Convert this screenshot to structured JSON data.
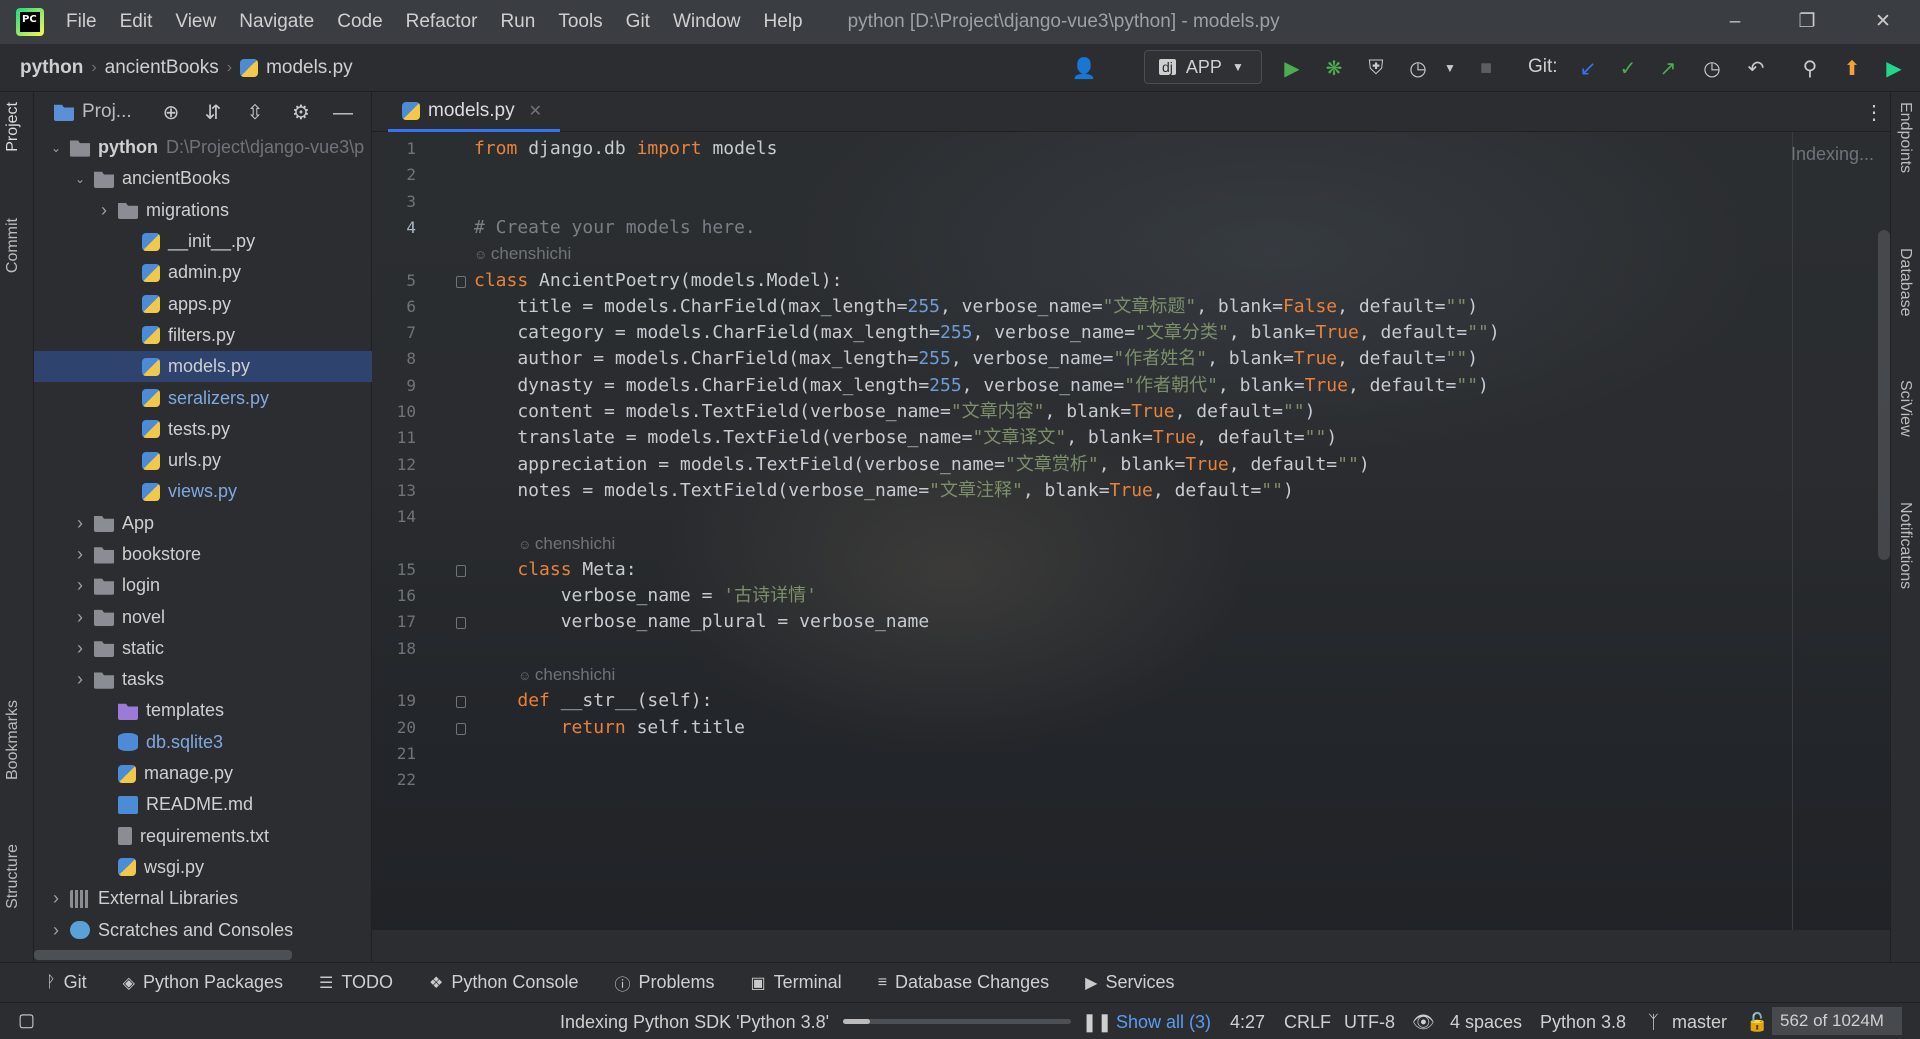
{
  "titlebar": {
    "menu": [
      "File",
      "Edit",
      "View",
      "Navigate",
      "Code",
      "Refactor",
      "Run",
      "Tools",
      "Git",
      "Window",
      "Help"
    ],
    "window_title": "python [D:\\Project\\django-vue3\\python] - models.py",
    "logo": "PC"
  },
  "navbar": {
    "breadcrumb": [
      "python",
      "ancientBooks",
      "models.py"
    ],
    "run_config": "APP",
    "git_label": "Git:"
  },
  "left_strip": {
    "tabs": [
      "Project",
      "Commit",
      "Bookmarks",
      "Structure"
    ]
  },
  "right_strip": {
    "tabs": [
      "Endpoints",
      "Database",
      "SciView",
      "Notifications"
    ]
  },
  "project_panel": {
    "title": "Proj...",
    "tree": [
      {
        "label": "python",
        "path": "D:\\Project\\django-vue3\\p",
        "type": "folder",
        "depth": 0,
        "expanded": true
      },
      {
        "label": "ancientBooks",
        "type": "folder",
        "depth": 1,
        "expanded": true
      },
      {
        "label": "migrations",
        "type": "folder",
        "depth": 2,
        "expanded": false
      },
      {
        "label": "__init__.py",
        "type": "py",
        "depth": 3
      },
      {
        "label": "admin.py",
        "type": "py",
        "depth": 3
      },
      {
        "label": "apps.py",
        "type": "py",
        "depth": 3
      },
      {
        "label": "filters.py",
        "type": "py",
        "depth": 3
      },
      {
        "label": "models.py",
        "type": "py",
        "depth": 3,
        "selected": true
      },
      {
        "label": "seralizers.py",
        "type": "py",
        "depth": 3,
        "blue": true
      },
      {
        "label": "tests.py",
        "type": "py",
        "depth": 3
      },
      {
        "label": "urls.py",
        "type": "py",
        "depth": 3
      },
      {
        "label": "views.py",
        "type": "py",
        "depth": 3,
        "blue": true
      },
      {
        "label": "App",
        "type": "folder",
        "depth": 1,
        "expanded": false
      },
      {
        "label": "bookstore",
        "type": "folder",
        "depth": 1,
        "expanded": false
      },
      {
        "label": "login",
        "type": "folder",
        "depth": 1,
        "expanded": false
      },
      {
        "label": "novel",
        "type": "folder",
        "depth": 1,
        "expanded": false
      },
      {
        "label": "static",
        "type": "folder",
        "depth": 1,
        "expanded": false
      },
      {
        "label": "tasks",
        "type": "folder",
        "depth": 1,
        "expanded": false
      },
      {
        "label": "templates",
        "type": "folder-purple",
        "depth": 2
      },
      {
        "label": "db.sqlite3",
        "type": "db",
        "depth": 2,
        "blue": true
      },
      {
        "label": "manage.py",
        "type": "py",
        "depth": 2
      },
      {
        "label": "README.md",
        "type": "md",
        "depth": 2
      },
      {
        "label": "requirements.txt",
        "type": "txt",
        "depth": 2
      },
      {
        "label": "wsgi.py",
        "type": "py",
        "depth": 2
      },
      {
        "label": "External Libraries",
        "type": "lib",
        "depth": 0,
        "expanded": false
      },
      {
        "label": "Scratches and Consoles",
        "type": "scratch",
        "depth": 0,
        "expanded": false
      }
    ]
  },
  "editor": {
    "tab": "models.py",
    "indexing_hint": "Indexing...",
    "author_hint": "chenshichi",
    "lines": [
      {
        "n": "1",
        "html": "<span class='kw'>from</span> django.db <span class='kw'>import</span> models"
      },
      {
        "n": "2",
        "html": ""
      },
      {
        "n": "3",
        "html": ""
      },
      {
        "n": "4",
        "html": "<span class='cmt'># Create your models here.</span>",
        "current": true
      },
      {
        "inlay": true,
        "indent": 0
      },
      {
        "n": "5",
        "html": "<span class='kw'>class</span> AncientPoetry(models.Model):",
        "fold": true
      },
      {
        "n": "6",
        "html": "    title = models.CharField(max_length=<span class='num'>255</span>, verbose_name=<span class='str'>\"文章标题\"</span>, blank=<span class='kw'>False</span>, default=<span class='str'>\"\"</span>)"
      },
      {
        "n": "7",
        "html": "    category = models.CharField(max_length=<span class='num'>255</span>, verbose_name=<span class='str'>\"文章分类\"</span>, blank=<span class='kw'>True</span>, default=<span class='str'>\"\"</span>)"
      },
      {
        "n": "8",
        "html": "    author = models.CharField(max_length=<span class='num'>255</span>, verbose_name=<span class='str'>\"作者姓名\"</span>, blank=<span class='kw'>True</span>, default=<span class='str'>\"\"</span>)"
      },
      {
        "n": "9",
        "html": "    dynasty = models.CharField(max_length=<span class='num'>255</span>, verbose_name=<span class='str'>\"作者朝代\"</span>, blank=<span class='kw'>True</span>, default=<span class='str'>\"\"</span>)"
      },
      {
        "n": "10",
        "html": "    content = models.TextField(verbose_name=<span class='str'>\"文章内容\"</span>, blank=<span class='kw'>True</span>, default=<span class='str'>\"\"</span>)"
      },
      {
        "n": "11",
        "html": "    translate = models.TextField(verbose_name=<span class='str'>\"文章译文\"</span>, blank=<span class='kw'>True</span>, default=<span class='str'>\"\"</span>)"
      },
      {
        "n": "12",
        "html": "    appreciation = models.TextField(verbose_name=<span class='str'>\"文章赏析\"</span>, blank=<span class='kw'>True</span>, default=<span class='str'>\"\"</span>)"
      },
      {
        "n": "13",
        "html": "    notes = models.TextField(verbose_name=<span class='str'>\"文章注释\"</span>, blank=<span class='kw'>True</span>, default=<span class='str'>\"\"</span>)"
      },
      {
        "n": "14",
        "html": ""
      },
      {
        "inlay": true,
        "indent": 4
      },
      {
        "n": "15",
        "html": "    <span class='kw'>class</span> Meta:",
        "fold": true
      },
      {
        "n": "16",
        "html": "        verbose_name = <span class='str'>'古诗详情'</span>"
      },
      {
        "n": "17",
        "html": "        verbose_name_plural = verbose_name",
        "fold": true
      },
      {
        "n": "18",
        "html": ""
      },
      {
        "inlay": true,
        "indent": 4
      },
      {
        "n": "19",
        "html": "    <span class='kw'>def</span> __str__(self):",
        "fold": true
      },
      {
        "n": "20",
        "html": "        <span class='kw'>return</span> self.title",
        "fold": true
      },
      {
        "n": "21",
        "html": ""
      },
      {
        "n": "22",
        "html": ""
      }
    ]
  },
  "bottom_tools": [
    {
      "label": "Git",
      "icon": "branch-icon"
    },
    {
      "label": "Python Packages",
      "icon": "packages-icon"
    },
    {
      "label": "TODO",
      "icon": "todo-icon"
    },
    {
      "label": "Python Console",
      "icon": "python-console-icon"
    },
    {
      "label": "Problems",
      "icon": "problems-icon"
    },
    {
      "label": "Terminal",
      "icon": "terminal-icon"
    },
    {
      "label": "Database Changes",
      "icon": "database-changes-icon"
    },
    {
      "label": "Services",
      "icon": "services-icon"
    }
  ],
  "statusbar": {
    "indexing_text": "Indexing Python SDK 'Python 3.8'",
    "progress": 0.12,
    "show_all": "Show all (3)",
    "position": "4:27",
    "line_sep": "CRLF",
    "encoding": "UTF-8",
    "indent": "4 spaces",
    "interpreter": "Python 3.8",
    "branch": "master",
    "memory": "562 of 1024M"
  },
  "colors": {
    "accent": "#3574f0",
    "keyword": "#e8823a",
    "number": "#6d9cd6",
    "string": "#7b8f6a",
    "selected_row": "#2e436e"
  }
}
